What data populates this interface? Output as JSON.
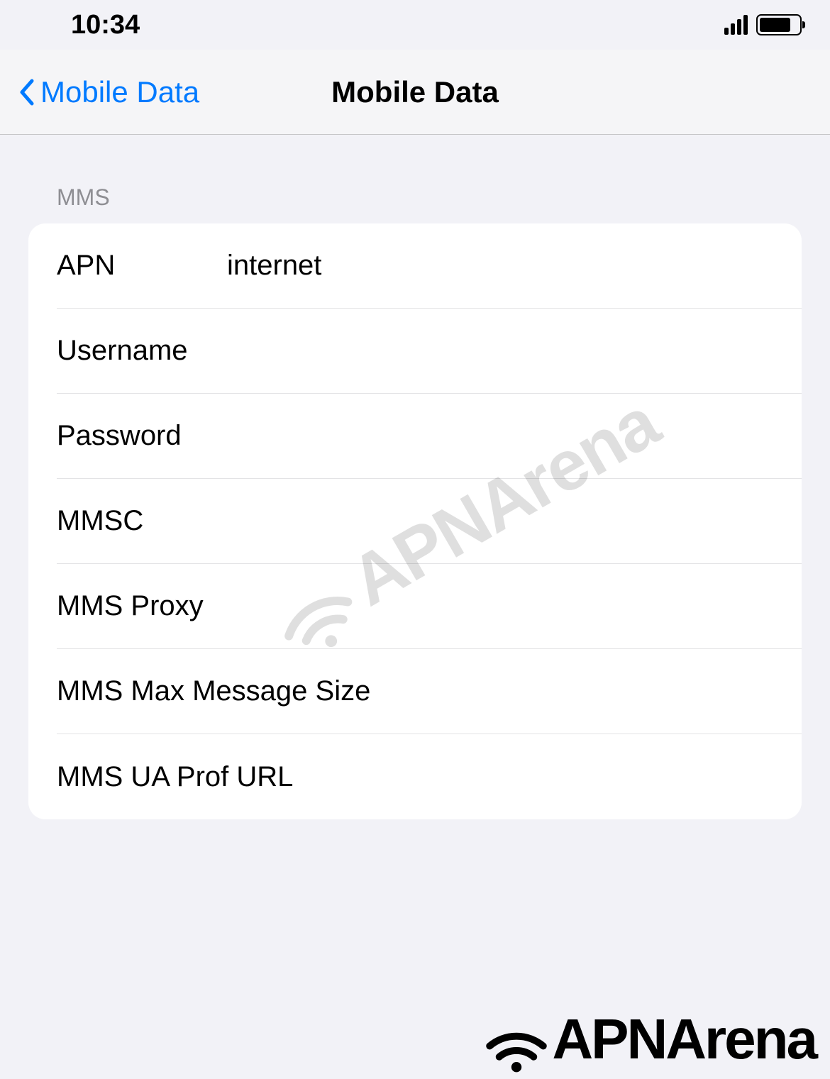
{
  "status_bar": {
    "time": "10:34"
  },
  "nav": {
    "back_label": "Mobile Data",
    "title": "Mobile Data"
  },
  "section": {
    "header": "MMS",
    "rows": [
      {
        "label": "APN",
        "value": "internet"
      },
      {
        "label": "Username",
        "value": ""
      },
      {
        "label": "Password",
        "value": ""
      },
      {
        "label": "MMSC",
        "value": ""
      },
      {
        "label": "MMS Proxy",
        "value": ""
      },
      {
        "label": "MMS Max Message Size",
        "value": ""
      },
      {
        "label": "MMS UA Prof URL",
        "value": ""
      }
    ]
  },
  "watermark": {
    "text": "APNArena"
  },
  "logo": {
    "text": "APNArena"
  }
}
